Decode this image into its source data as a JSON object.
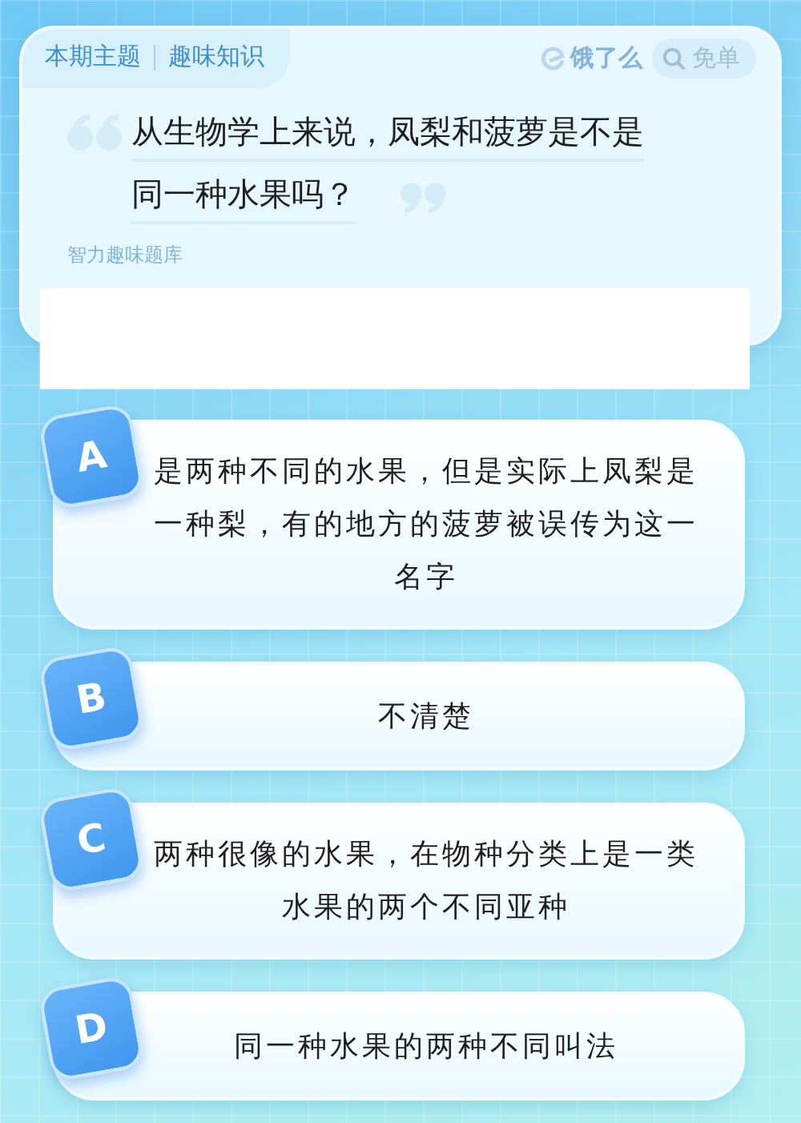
{
  "header": {
    "topic_label": "本期主题",
    "topic": "趣味知识",
    "brand": "饿了么",
    "badge": "免单"
  },
  "question": {
    "lines": [
      "从生物学上来说，凤梨和菠萝是不是",
      "同一种水果吗？"
    ],
    "source": "智力趣味题库"
  },
  "options": [
    {
      "letter": "A",
      "text": "是两种不同的水果，但是实际上凤梨是一种梨，有的地方的菠萝被误传为这一名字"
    },
    {
      "letter": "B",
      "text": "不清楚"
    },
    {
      "letter": "C",
      "text": "两种很像的水果，在物种分类上是一类水果的两个不同亚种"
    },
    {
      "letter": "D",
      "text": "同一种水果的两种不同叫法"
    }
  ]
}
